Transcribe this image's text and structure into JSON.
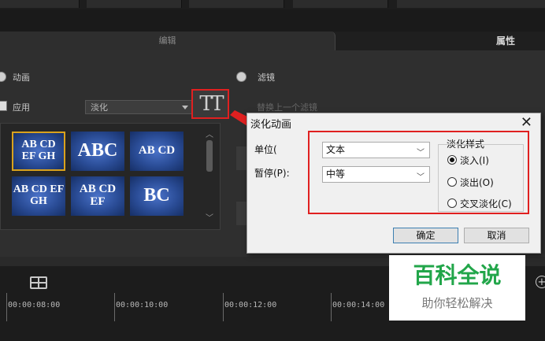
{
  "tabs": {
    "edit": "编辑",
    "properties": "属性"
  },
  "panel": {
    "animation_label": "动画",
    "filter_label": "滤镜",
    "apply_label": "应用",
    "replace_filter_label": "替换上一个滤镜",
    "transition_value": "淡化",
    "tt_glyph": "TT"
  },
  "thumbnails": [
    {
      "text": "AB CD EF GH",
      "selected": true
    },
    {
      "text": "ABC",
      "selected": false
    },
    {
      "text": "AB CD",
      "selected": false
    },
    {
      "text": "AB CD EF GH",
      "selected": false
    },
    {
      "text": "AB CD EF",
      "selected": false
    },
    {
      "text": "BC",
      "selected": false
    }
  ],
  "dialog": {
    "title": "淡化动画",
    "unit_label": "单位(",
    "pause_label": "暂停(P):",
    "unit_value": "文本",
    "pause_value": "中等",
    "style_group": "淡化样式",
    "options": [
      "淡入(I)",
      "淡出(O)",
      "交叉淡化(C)"
    ],
    "selected_option": 0,
    "ok": "确定",
    "cancel": "取消"
  },
  "timeline": {
    "times": [
      "00:00:08:00",
      "00:00:10:00",
      "00:00:12:00",
      "00:00:14:00"
    ]
  },
  "watermark": {
    "title": "百科全说",
    "subtitle": "助你轻松解决"
  },
  "colors": {
    "highlight": "#e02020",
    "selection": "#d9a21d",
    "watermark": "#22a64a"
  }
}
